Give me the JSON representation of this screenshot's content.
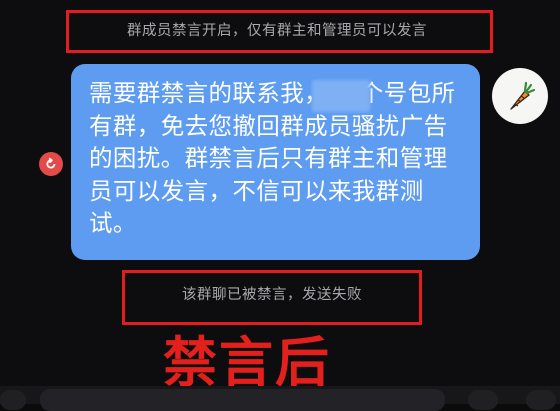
{
  "chat": {
    "system_notice": "群成员禁言开启，仅有群主和管理员可以发言",
    "message": {
      "text": "需要群禁言的联系我，          一个号包所有群，免去您撤回群成员骚扰广告的困扰。群禁言后只有群主和管理员可以发言，不信可以来我群测试。",
      "bubble_color": "#5d9cf0",
      "avatar_icon": "carrot-icon",
      "status_icon": "resend-icon"
    },
    "failure_notice": "该群聊已被禁言，发送失败"
  },
  "annotation": {
    "caption": "禁言后",
    "color": "#e51c1c"
  }
}
